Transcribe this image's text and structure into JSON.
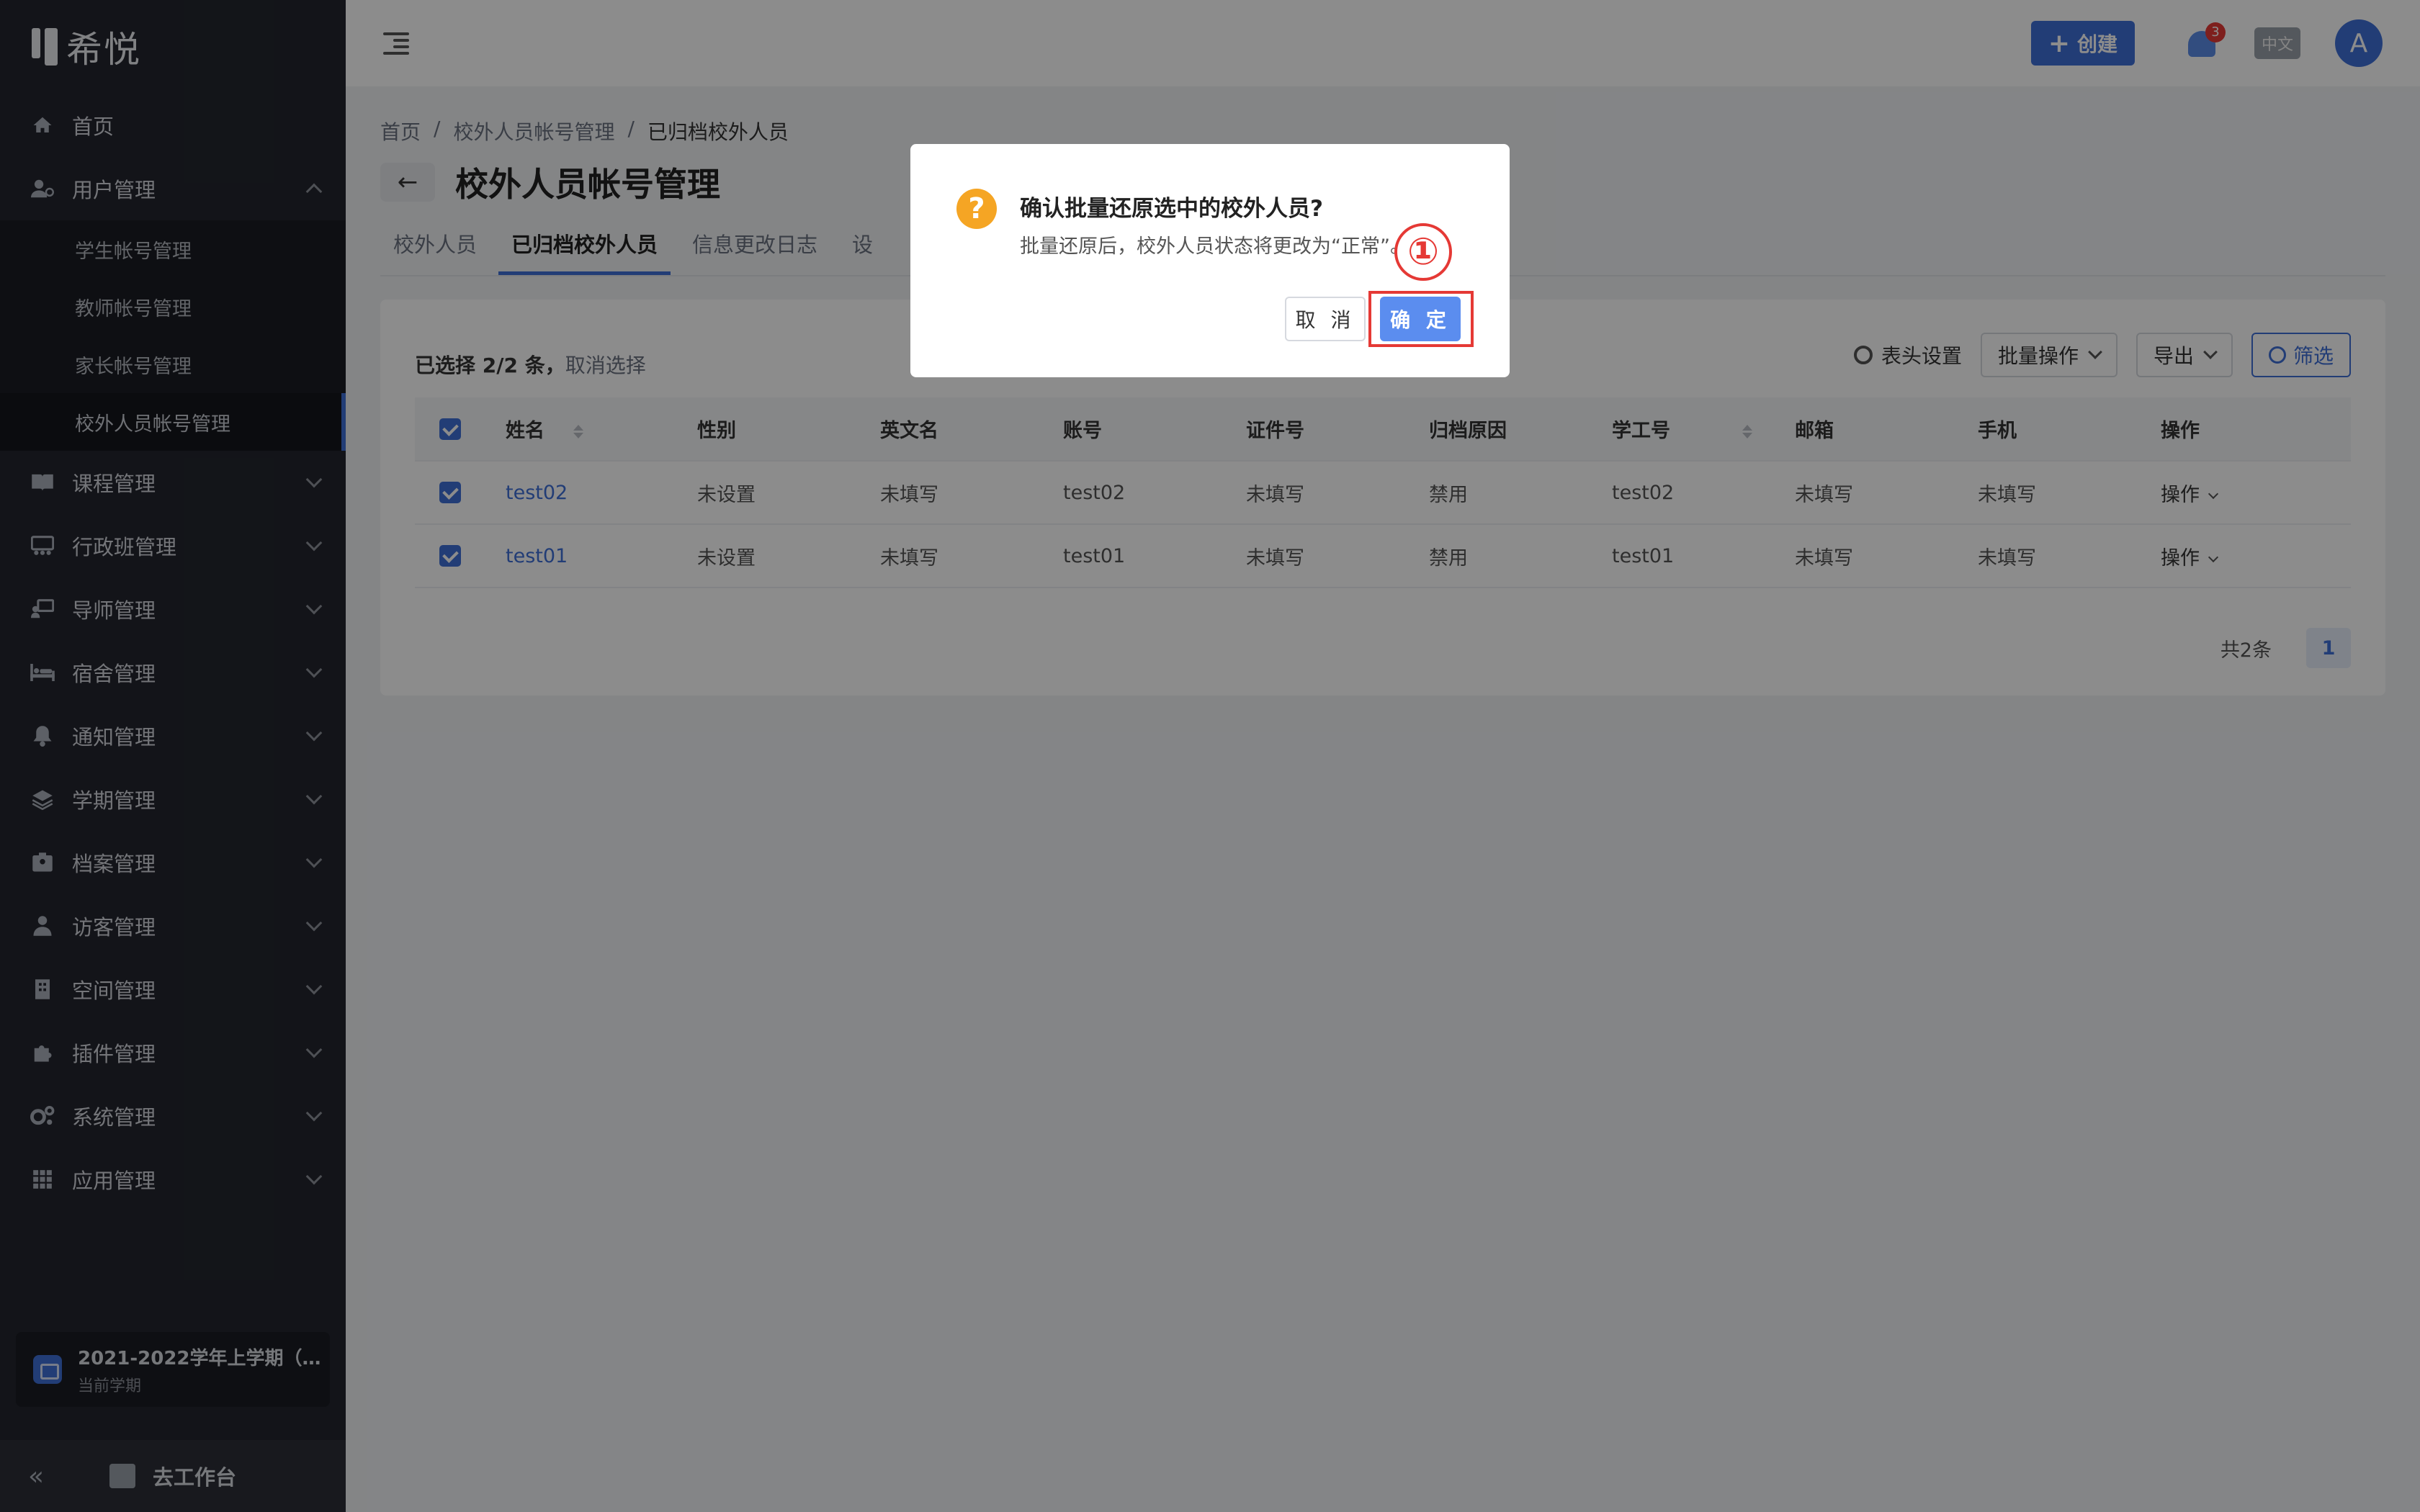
{
  "app": {
    "name": "希悦"
  },
  "sidebar": {
    "items": [
      {
        "label": "首页",
        "icon": "home-icon"
      },
      {
        "label": "用户管理",
        "icon": "user-manage-icon",
        "expanded": true,
        "children": [
          "学生帐号管理",
          "教师帐号管理",
          "家长帐号管理",
          "校外人员帐号管理"
        ],
        "active_child": "校外人员帐号管理"
      },
      {
        "label": "课程管理",
        "icon": "book-icon"
      },
      {
        "label": "行政班管理",
        "icon": "classroom-icon"
      },
      {
        "label": "导师管理",
        "icon": "mentor-icon"
      },
      {
        "label": "宿舍管理",
        "icon": "bed-icon"
      },
      {
        "label": "通知管理",
        "icon": "bell-icon"
      },
      {
        "label": "学期管理",
        "icon": "layers-icon"
      },
      {
        "label": "档案管理",
        "icon": "archive-icon"
      },
      {
        "label": "访客管理",
        "icon": "visitor-icon"
      },
      {
        "label": "空间管理",
        "icon": "building-icon"
      },
      {
        "label": "插件管理",
        "icon": "puzzle-icon"
      },
      {
        "label": "系统管理",
        "icon": "gears-icon"
      },
      {
        "label": "应用管理",
        "icon": "grid-icon"
      }
    ],
    "term": {
      "title": "2021-2022学年上学期（…",
      "subtitle": "当前学期"
    },
    "collapse_label": "«",
    "workbench_label": "去工作台"
  },
  "header": {
    "create_label": "创建",
    "notification_count": "3",
    "lang_label": "中文",
    "avatar_letter": "A"
  },
  "breadcrumb": {
    "items": [
      "首页",
      "校外人员帐号管理",
      "已归档校外人员"
    ],
    "separator": "/"
  },
  "page": {
    "title": "校外人员帐号管理",
    "back_glyph": "←"
  },
  "tabs": [
    {
      "label": "校外人员",
      "active": false
    },
    {
      "label": "已归档校外人员",
      "active": true
    },
    {
      "label": "信息更改日志",
      "active": false
    },
    {
      "label": "设",
      "active": false
    }
  ],
  "selection": {
    "text": "已选择 2/2 条，",
    "clear_label": "取消选择"
  },
  "toolbar": {
    "column_settings": "表头设置",
    "batch_label": "批量操作",
    "export_label": "导出",
    "filter_label": "筛选"
  },
  "table": {
    "columns": [
      "姓名",
      "性别",
      "英文名",
      "账号",
      "证件号",
      "归档原因",
      "学工号",
      "邮箱",
      "手机",
      "操作"
    ],
    "rows": [
      {
        "name": "test02",
        "gender": "未设置",
        "en": "未填写",
        "account": "test02",
        "id": "未填写",
        "reason": "禁用",
        "staff_no": "test02",
        "email": "未填写",
        "phone": "未填写",
        "action": "操作"
      },
      {
        "name": "test01",
        "gender": "未设置",
        "en": "未填写",
        "account": "test01",
        "id": "未填写",
        "reason": "禁用",
        "staff_no": "test01",
        "email": "未填写",
        "phone": "未填写",
        "action": "操作"
      }
    ]
  },
  "pagination": {
    "total": "共2条",
    "current": "1"
  },
  "modal": {
    "title": "确认批量还原选中的校外人员?",
    "description": "批量还原后，校外人员状态将更改为“正常”。",
    "cancel_label": "取 消",
    "ok_label": "确 定",
    "annotation": "①"
  },
  "colors": {
    "accent": "#3f6fd8",
    "sidebar_bg": "#23262e",
    "warning": "#f5a524",
    "annotation": "#e53935"
  }
}
